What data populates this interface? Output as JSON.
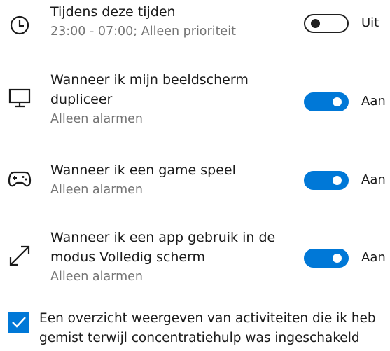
{
  "rules": [
    {
      "icon": "clock-icon",
      "title_lines": [
        "Tijdens deze tijden"
      ],
      "subtitle": "23:00 - 07:00; Alleen prioriteit",
      "toggle_on": false,
      "state_label": "Uit"
    },
    {
      "icon": "monitor-icon",
      "title_lines": [
        "Wanneer ik mijn beeldscherm",
        "dupliceer"
      ],
      "subtitle": "Alleen alarmen",
      "toggle_on": true,
      "state_label": "Aan"
    },
    {
      "icon": "gamepad-icon",
      "title_lines": [
        "Wanneer ik een game speel"
      ],
      "subtitle": "Alleen alarmen",
      "toggle_on": true,
      "state_label": "Aan"
    },
    {
      "icon": "fullscreen-arrow-icon",
      "title_lines": [
        "Wanneer ik een app gebruik in de",
        "modus Volledig scherm"
      ],
      "subtitle": "Alleen alarmen",
      "toggle_on": true,
      "state_label": "Aan"
    }
  ],
  "summary_checkbox": {
    "checked": true,
    "label_lines": [
      "Een overzicht weergeven van activiteiten die ik heb",
      "gemist terwijl concentratiehulp was ingeschakeld"
    ]
  },
  "colors": {
    "accent": "#0078d7",
    "subtitle_gray": "#747474",
    "text": "#1a1a1a"
  }
}
